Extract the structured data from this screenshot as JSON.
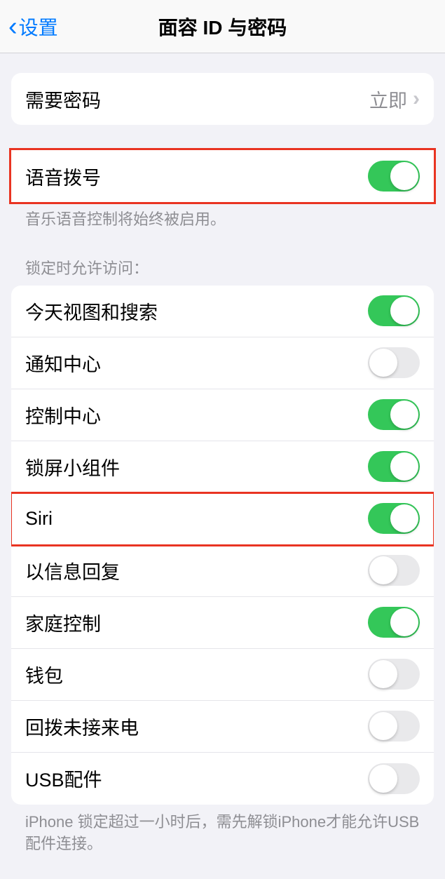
{
  "nav": {
    "back": "设置",
    "title": "面容 ID 与密码"
  },
  "passcode": {
    "label": "需要密码",
    "value": "立即"
  },
  "voice_dial": {
    "label": "语音拨号",
    "on": true,
    "footer": "音乐语音控制将始终被启用。"
  },
  "lockscreen": {
    "header": "锁定时允许访问：",
    "items": [
      {
        "label": "今天视图和搜索",
        "on": true
      },
      {
        "label": "通知中心",
        "on": false
      },
      {
        "label": "控制中心",
        "on": true
      },
      {
        "label": "锁屏小组件",
        "on": true
      },
      {
        "label": "Siri",
        "on": true,
        "highlight": true
      },
      {
        "label": "以信息回复",
        "on": false
      },
      {
        "label": "家庭控制",
        "on": true
      },
      {
        "label": "钱包",
        "on": false
      },
      {
        "label": "回拨未接来电",
        "on": false
      },
      {
        "label": "USB配件",
        "on": false
      }
    ],
    "footer": "iPhone 锁定超过一小时后，需先解锁iPhone才能允许USB配件连接。"
  }
}
